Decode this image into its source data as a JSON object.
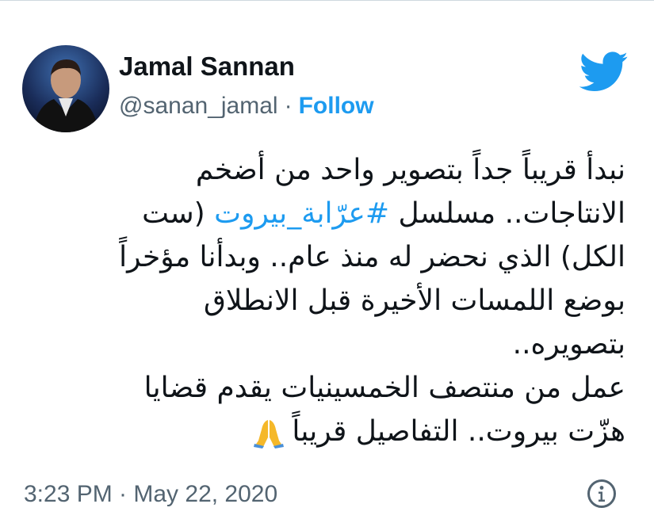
{
  "author": {
    "name": "Jamal Sannan",
    "handle": "@sanan_jamal",
    "separator": "·",
    "follow_label": "Follow"
  },
  "tweet": {
    "line1": "نبدأ قريباً جداً بتصوير واحد من أضخم",
    "line2_before": "الانتاجات.. مسلسل ",
    "line2_hashtag": "#عرّابة_بيروت",
    "line2_after": " (ست",
    "line3": "الكل) الذي نحضر له منذ عام.. وبدأنا مؤخراً",
    "line4": "بوضع اللمسات الأخيرة قبل الانطلاق",
    "line5": "بتصويره..",
    "line6": "عمل من منتصف الخمسينيات يقدم قضايا",
    "line7": "هزّت بيروت.. التفاصيل قريباً"
  },
  "meta": {
    "timestamp": "3:23 PM · May 22, 2020"
  },
  "icons": {
    "logo": "twitter-bird-icon",
    "emoji": "folded-hands-emoji-icon",
    "info": "info-icon"
  },
  "colors": {
    "accent": "#1d9bf0",
    "text": "#0f1419",
    "secondary": "#536471",
    "emoji": "#f5b829"
  }
}
